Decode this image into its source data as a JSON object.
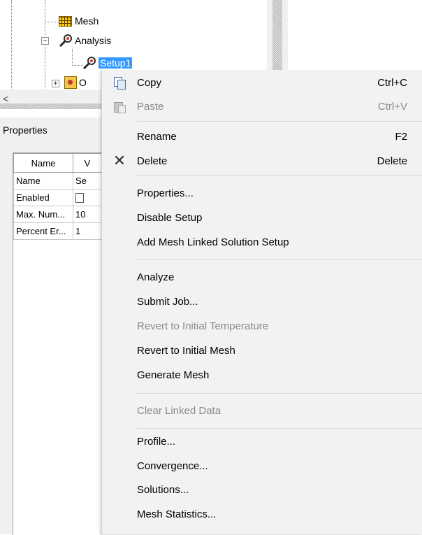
{
  "tree": {
    "items": [
      {
        "label": "Mesh",
        "icon": "mesh-icon"
      },
      {
        "label": "Analysis",
        "icon": "analysis-icon",
        "expander": "−"
      },
      {
        "label": "Setup1",
        "icon": "setup-icon",
        "selected": true
      },
      {
        "label": "O",
        "icon": "optimetrics-icon",
        "expander": "+"
      }
    ]
  },
  "hscroll": {
    "left_arrow": "<"
  },
  "properties": {
    "title": "Properties",
    "columns": [
      "Name",
      "V"
    ],
    "rows": [
      {
        "name": "Name",
        "value": "Se"
      },
      {
        "name": "Enabled",
        "value": ""
      },
      {
        "name": "Max. Num...",
        "value": "10"
      },
      {
        "name": "Percent Er...",
        "value": "1"
      }
    ]
  },
  "context_menu": {
    "items": [
      {
        "label": "Copy",
        "shortcut": "Ctrl+C",
        "icon": "copy-icon",
        "enabled": true
      },
      {
        "label": "Paste",
        "shortcut": "Ctrl+V",
        "icon": "paste-icon",
        "enabled": false
      },
      {
        "label": "Rename",
        "shortcut": "F2",
        "enabled": true
      },
      {
        "label": "Delete",
        "shortcut": "Delete",
        "icon": "delete-icon",
        "enabled": true
      },
      {
        "label": "Properties...",
        "enabled": true
      },
      {
        "label": "Disable Setup",
        "enabled": true
      },
      {
        "label": "Add Mesh Linked Solution Setup",
        "enabled": true
      },
      {
        "label": "Analyze",
        "enabled": true
      },
      {
        "label": "Submit Job...",
        "enabled": true
      },
      {
        "label": "Revert to Initial Temperature",
        "enabled": false
      },
      {
        "label": "Revert to Initial Mesh",
        "enabled": true
      },
      {
        "label": "Generate Mesh",
        "enabled": true
      },
      {
        "label": "Clear Linked Data",
        "enabled": false
      },
      {
        "label": "Profile...",
        "enabled": true
      },
      {
        "label": "Convergence...",
        "enabled": true
      },
      {
        "label": "Solutions...",
        "enabled": true
      },
      {
        "label": "Mesh Statistics...",
        "enabled": true
      }
    ]
  },
  "colors": {
    "selection": "#3399ff",
    "menu_background": "#f2f2f2",
    "disabled_text": "#8a8a8a"
  }
}
